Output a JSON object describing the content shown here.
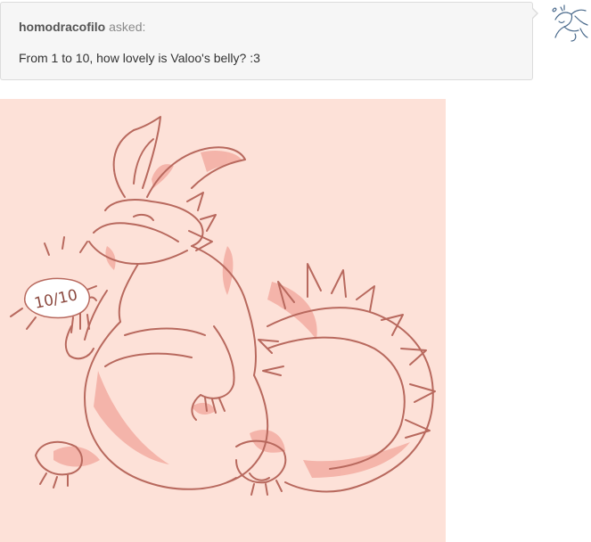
{
  "ask": {
    "asker": "homodracofilo",
    "asked_label": "asked:",
    "question": "From 1 to 10, how lovely is Valoo's belly? :3"
  },
  "avatar": {
    "icon": "dragon-sketch-avatar-icon"
  },
  "artwork": {
    "speech_text": "10/10",
    "background_color": "#fde1d8",
    "line_color": "#b8695e",
    "shade_color": "#f2a69b"
  }
}
